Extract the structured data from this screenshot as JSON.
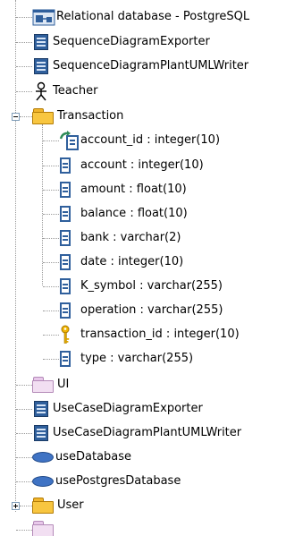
{
  "tree": {
    "items": [
      {
        "label": "Relational database - PostgreSQL",
        "icon": "database-diagram-icon"
      },
      {
        "label": "SequenceDiagramExporter",
        "icon": "class-icon"
      },
      {
        "label": "SequenceDiagramPlantUMLWriter",
        "icon": "class-icon"
      },
      {
        "label": "Teacher",
        "icon": "actor-icon"
      },
      {
        "label": "Transaction",
        "icon": "package-icon",
        "expanded": true,
        "children": [
          {
            "label": "account_id : integer(10)",
            "icon": "foreign-key-attribute-icon"
          },
          {
            "label": "account : integer(10)",
            "icon": "attribute-icon"
          },
          {
            "label": "amount : float(10)",
            "icon": "attribute-icon"
          },
          {
            "label": "balance : float(10)",
            "icon": "attribute-icon"
          },
          {
            "label": "bank : varchar(2)",
            "icon": "attribute-icon"
          },
          {
            "label": "date : integer(10)",
            "icon": "attribute-icon"
          },
          {
            "label": "K_symbol : varchar(255)",
            "icon": "attribute-icon"
          },
          {
            "label": "operation : varchar(255)",
            "icon": "attribute-icon"
          },
          {
            "label": "transaction_id : integer(10)",
            "icon": "primary-key-icon"
          },
          {
            "label": "type : varchar(255)",
            "icon": "attribute-icon"
          }
        ]
      },
      {
        "label": "UI",
        "icon": "package-icon"
      },
      {
        "label": "UseCaseDiagramExporter",
        "icon": "class-icon"
      },
      {
        "label": "UseCaseDiagramPlantUMLWriter",
        "icon": "class-icon"
      },
      {
        "label": "useDatabase",
        "icon": "use-case-icon"
      },
      {
        "label": "usePostgresDatabase",
        "icon": "use-case-icon"
      },
      {
        "label": "User",
        "icon": "package-icon",
        "expanded": false
      },
      {
        "label": "",
        "icon": "package-icon"
      }
    ]
  },
  "colors": {
    "class_blue": "#2f5f9c",
    "package_yellow": "#f8c640",
    "package_pink": "#f2dff2",
    "use_case_blue": "#3f73c4",
    "key_gold": "#e0a800",
    "connector_gray": "#9a9a9a"
  }
}
